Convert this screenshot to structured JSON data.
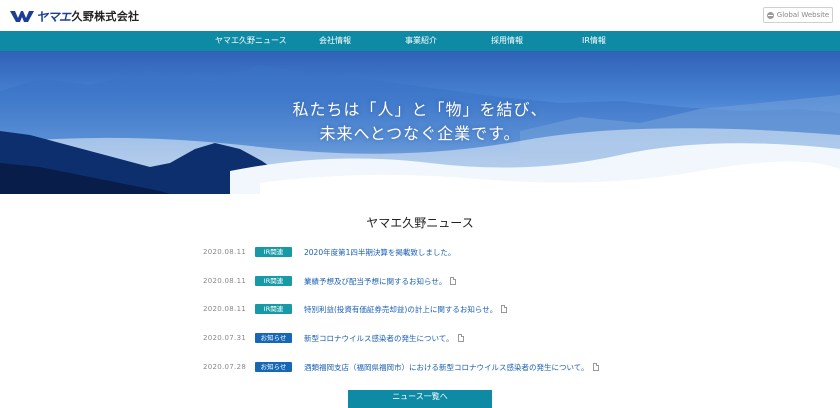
{
  "header": {
    "logo_katakana": "ヤマエ",
    "logo_name": "久野株式会社",
    "global_button": "Global Website"
  },
  "nav": {
    "items": [
      {
        "label": "ヤマエ久野ニュース"
      },
      {
        "label": "会社情報"
      },
      {
        "label": "事業紹介"
      },
      {
        "label": "採用情報"
      },
      {
        "label": "IR情報"
      }
    ]
  },
  "hero": {
    "line1": "私たちは「人」と「物」を結び、",
    "line2": "未来へとつなぐ企業です。"
  },
  "news": {
    "title": "ヤマエ久野ニュース",
    "items": [
      {
        "date": "2020.08.11",
        "category": "IR関連",
        "title": "2020年度第1四半期決算を掲載致しました。",
        "pdf": false
      },
      {
        "date": "2020.08.11",
        "category": "IR関連",
        "title": "業績予想及び配当予想に関するお知らせ。",
        "pdf": true
      },
      {
        "date": "2020.08.11",
        "category": "IR関連",
        "title": "特別利益(投資有価証券売却益)の計上に関するお知らせ。",
        "pdf": true
      },
      {
        "date": "2020.07.31",
        "category": "お知らせ",
        "title": "新型コロナウイルス感染者の発生について。",
        "pdf": true
      },
      {
        "date": "2020.07.28",
        "category": "お知らせ",
        "title": "酒類福岡支店（福岡県福岡市）における新型コロナウイルス感染者の発生について。",
        "pdf": true
      }
    ],
    "more_button": "ニュース一覧へ"
  },
  "colors": {
    "nav_bg": "#0f8aa5",
    "badge_ir": "#179aa6",
    "badge_info": "#1667b5",
    "link": "#1a5fb4",
    "logo_blue": "#1a3f95"
  },
  "icons": [
    "yamae-logo-mark",
    "globe-icon",
    "pdf-icon"
  ]
}
